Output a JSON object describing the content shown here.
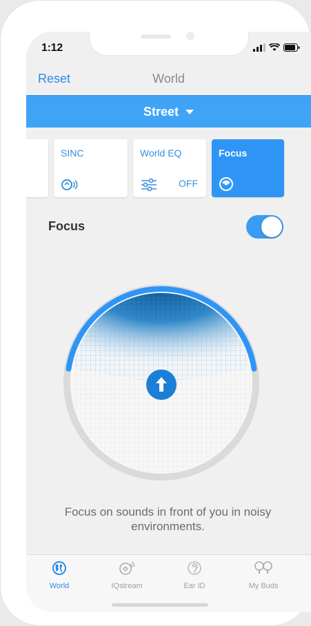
{
  "status_bar": {
    "time": "1:12"
  },
  "nav": {
    "reset_label": "Reset",
    "title": "World"
  },
  "environment": {
    "selected": "Street"
  },
  "mode_cards": [
    {
      "label": "SINC",
      "icon": "sinc-icon"
    },
    {
      "label": "World EQ",
      "icon": "sliders-icon",
      "value": "OFF"
    },
    {
      "label": "Focus",
      "icon": "focus-icon",
      "active": true
    }
  ],
  "focus": {
    "label": "Focus",
    "enabled": true
  },
  "description": "Focus on sounds in front of you in noisy environments.",
  "tabs": [
    {
      "label": "World",
      "icon": "globe-icon",
      "active": true
    },
    {
      "label": "IQstream",
      "icon": "iqstream-icon"
    },
    {
      "label": "Ear ID",
      "icon": "ear-icon"
    },
    {
      "label": "My Buds",
      "icon": "earbuds-icon"
    }
  ],
  "colors": {
    "accent": "#2f8be6",
    "bar": "#40a4f6",
    "active_card": "#2f95f5"
  }
}
